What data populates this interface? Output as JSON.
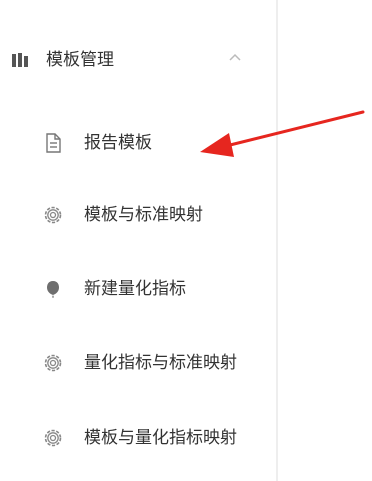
{
  "sidebar": {
    "group": {
      "title": "模板管理",
      "icon": "bar-chart-icon",
      "expanded_icon": "chevron-up-icon"
    },
    "items": [
      {
        "label": "报告模板",
        "icon": "document-icon"
      },
      {
        "label": "模板与标准映射",
        "icon": "gear-icon"
      },
      {
        "label": "新建量化指标",
        "icon": "balloon-icon"
      },
      {
        "label": "量化指标与标准映射",
        "icon": "gear-icon"
      },
      {
        "label": "模板与量化指标映射",
        "icon": "gear-icon"
      }
    ]
  },
  "annotation": {
    "arrow_color": "#e6261f"
  }
}
